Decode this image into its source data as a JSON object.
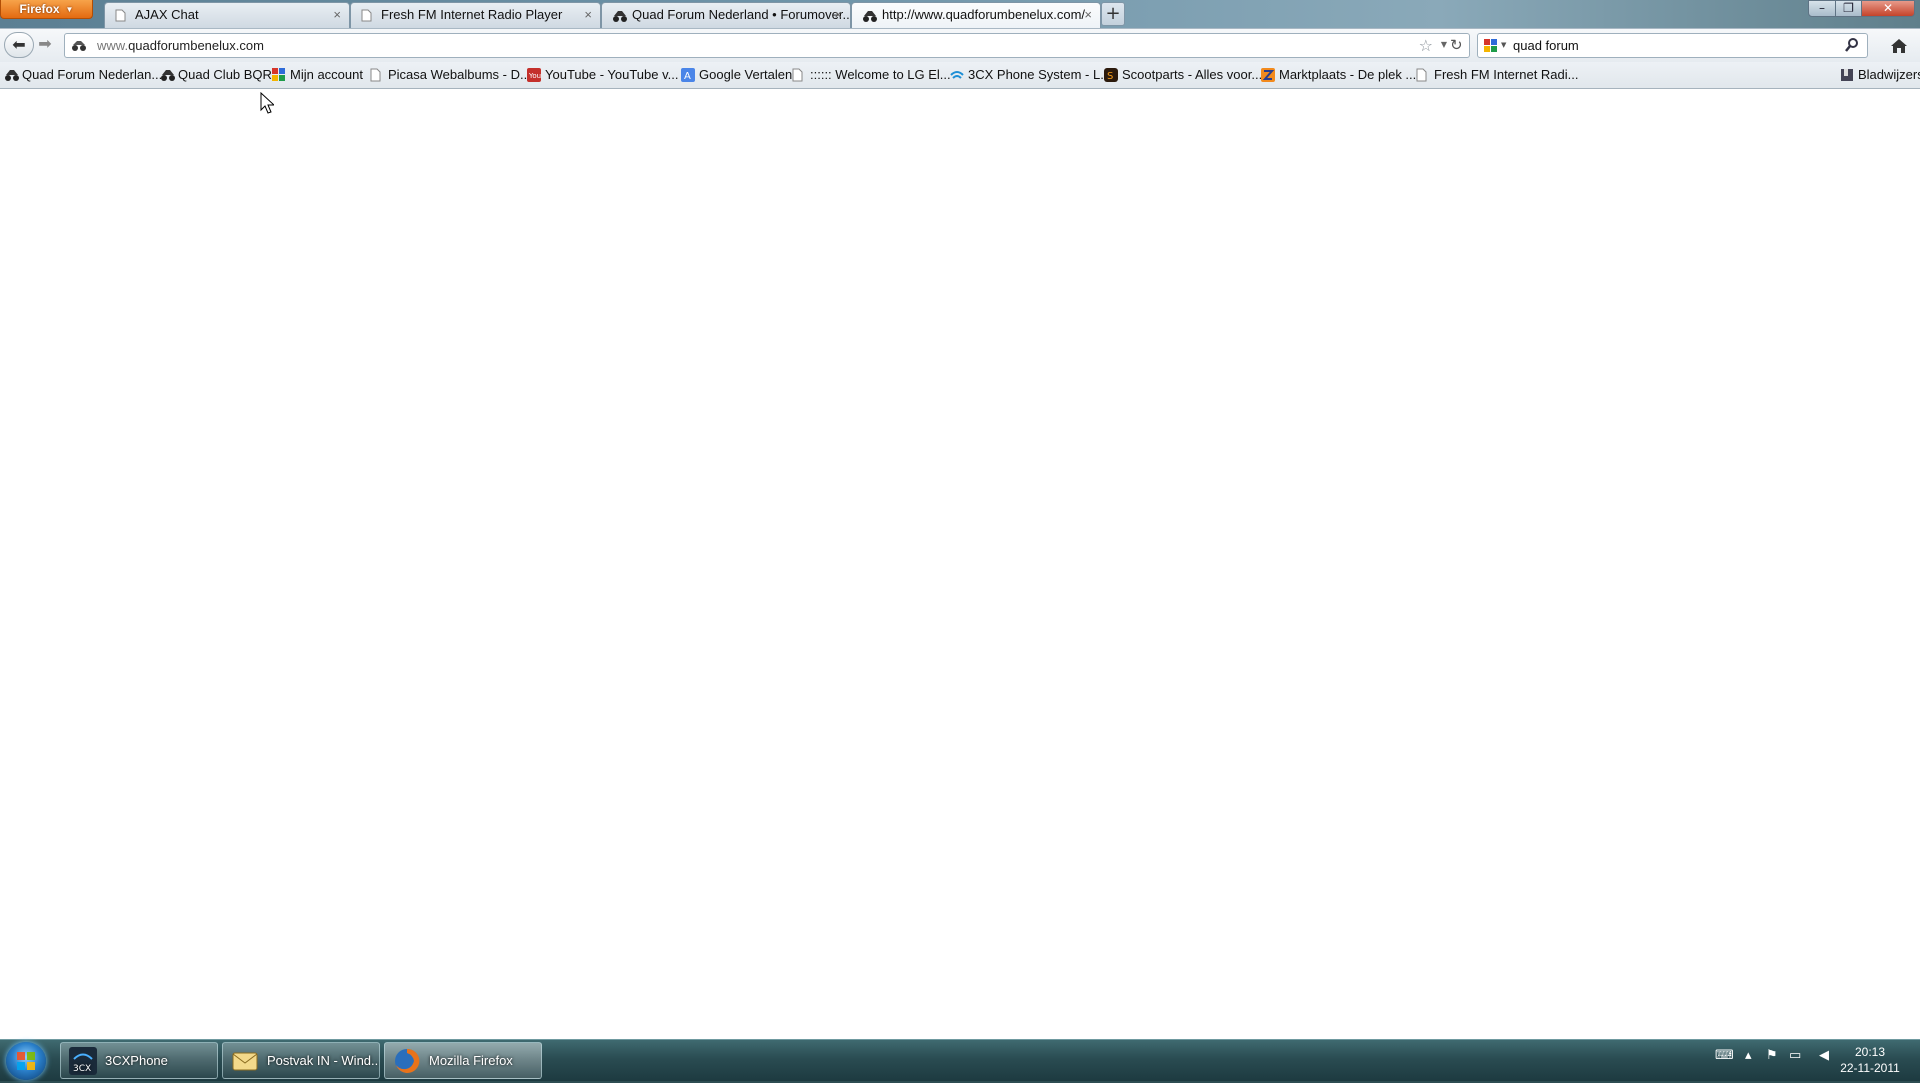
{
  "browser": {
    "menu_button": "Firefox",
    "tabs": [
      {
        "title": "AJAX Chat",
        "icon": "page-icon"
      },
      {
        "title": "Fresh FM Internet Radio Player",
        "icon": "page-icon"
      },
      {
        "title": "Quad Forum Nederland • Forumover...",
        "icon": "quad-icon"
      },
      {
        "title": "http://www.quadforumbenelux.com/",
        "icon": "quad-icon",
        "active": true
      }
    ],
    "new_tab": "+"
  },
  "navbar": {
    "url_prefix": "www.",
    "url_host": "quadforumbenelux.com",
    "search_value": "quad forum"
  },
  "bookmarks": [
    {
      "label": "Quad Forum Nederlan...",
      "icon": "quad-icon"
    },
    {
      "label": "Quad Club BQR",
      "icon": "quad-icon"
    },
    {
      "label": "Mijn account",
      "icon": "google-icon"
    },
    {
      "label": "Picasa Webalbums - D...",
      "icon": "page-icon"
    },
    {
      "label": "YouTube - YouTube v...",
      "icon": "youtube-icon"
    },
    {
      "label": "Google Vertalen",
      "icon": "translate-icon"
    },
    {
      "label": ":::::: Welcome to LG El...",
      "icon": "page-icon"
    },
    {
      "label": "3CX Phone System - L...",
      "icon": "3cx-icon"
    },
    {
      "label": "Scootparts - Alles voor...",
      "icon": "scootparts-icon"
    },
    {
      "label": "Marktplaats - De plek ...",
      "icon": "marktplaats-icon"
    },
    {
      "label": "Fresh FM Internet Radi...",
      "icon": "page-icon"
    }
  ],
  "bookmarks_menu": "Bladwijzers",
  "taskbar": {
    "tasks": [
      {
        "label": "3CXPhone",
        "icon": "3cx-icon"
      },
      {
        "label": "Postvak IN - Wind...",
        "icon": "mail-icon"
      },
      {
        "label": "Mozilla Firefox",
        "icon": "firefox-icon",
        "active": true
      }
    ],
    "clock_time": "20:13",
    "clock_date": "22-11-2011"
  },
  "colors": {
    "firefox_orange": "#e36a10",
    "taskbar_teal": "#2a4c52",
    "content_bg": "#ffffff"
  }
}
